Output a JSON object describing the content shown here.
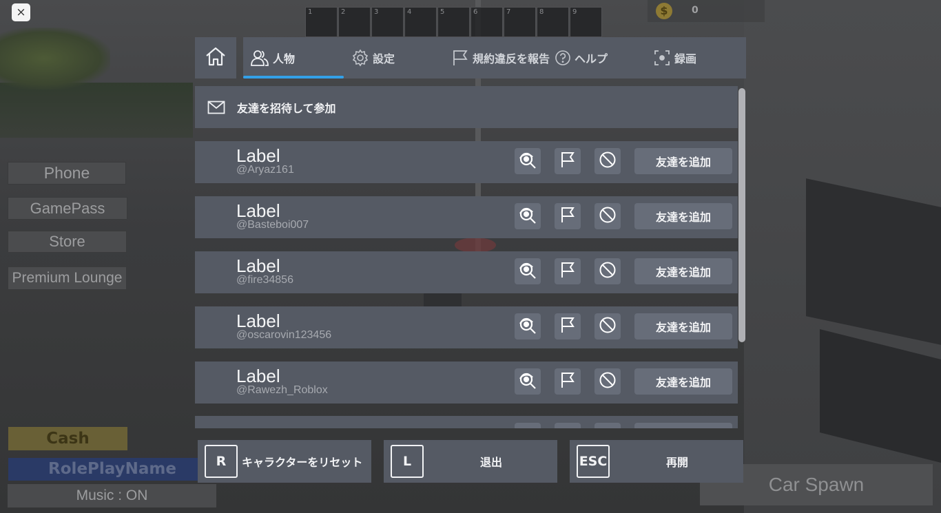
{
  "close_label": "×",
  "hotbar": [
    "1",
    "2",
    "3",
    "4",
    "5",
    "6",
    "7",
    "8",
    "9"
  ],
  "currency": {
    "icon": "coin-icon",
    "symbol": "$",
    "value": "0"
  },
  "side_buttons": {
    "phone": "Phone",
    "gamepass": "GamePass",
    "store": "Store",
    "premium_lounge": "Premium Lounge",
    "cash": "Cash",
    "roleplay_name": "RolePlayName",
    "music": "Music : ON",
    "car_spawn": "Car Spawn"
  },
  "menu": {
    "home_icon": "home-icon",
    "tabs": [
      {
        "label": "人物",
        "icon": "people-icon",
        "active": true
      },
      {
        "label": "設定",
        "icon": "gear-icon",
        "active": false
      },
      {
        "label": "規約違反を報告",
        "icon": "flag-icon",
        "active": false
      },
      {
        "label": "ヘルプ",
        "icon": "help-icon",
        "active": false
      },
      {
        "label": "録画",
        "icon": "record-icon",
        "active": false
      }
    ],
    "accent_color": "#33a0e8",
    "invite": {
      "icon": "mail-icon",
      "label": "友達を招待して参加"
    },
    "players": [
      {
        "name": "Label",
        "handle": "@Aryaz161",
        "add_label": "友達を追加"
      },
      {
        "name": "Label",
        "handle": "@Basteboi007",
        "add_label": "友達を追加"
      },
      {
        "name": "Label",
        "handle": "@fire34856",
        "add_label": "友達を追加"
      },
      {
        "name": "Label",
        "handle": "@oscarovin123456",
        "add_label": "友達を追加"
      },
      {
        "name": "Label",
        "handle": "@Rawezh_Roblox",
        "add_label": "友達を追加"
      }
    ],
    "bottom": [
      {
        "key": "R",
        "label": "キャラクターをリセット"
      },
      {
        "key": "L",
        "label": "退出"
      },
      {
        "key": "ESC",
        "label": "再開"
      }
    ]
  }
}
